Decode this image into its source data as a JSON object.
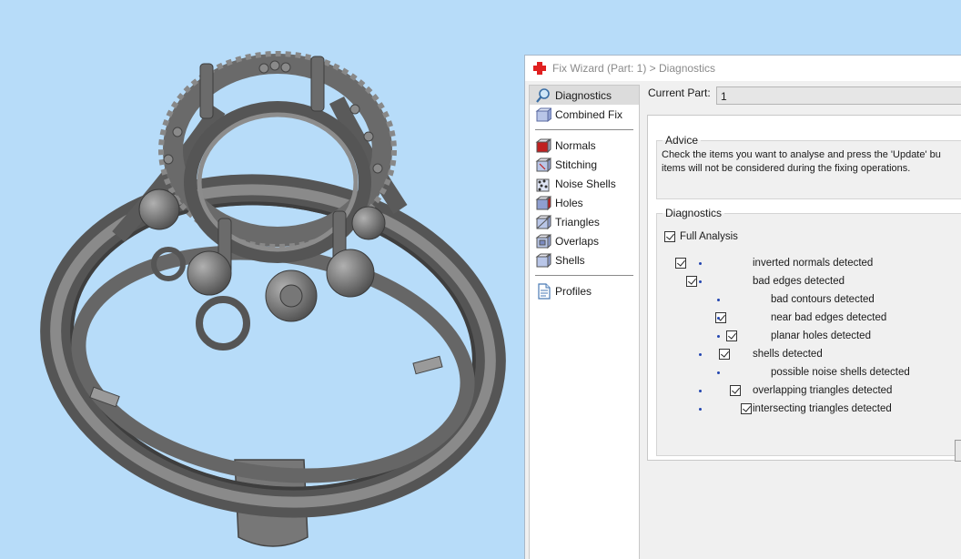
{
  "window": {
    "title": "Fix Wizard (Part: 1) > Diagnostics"
  },
  "nav": {
    "top_items": [
      {
        "label": "Diagnostics",
        "icon": "magnifier-icon",
        "selected": true
      },
      {
        "label": "Combined Fix",
        "icon": "combined-fix-icon",
        "selected": false
      }
    ],
    "fix_items": [
      {
        "label": "Normals",
        "icon": "normals-icon"
      },
      {
        "label": "Stitching",
        "icon": "stitching-icon"
      },
      {
        "label": "Noise Shells",
        "icon": "noise-shells-icon"
      },
      {
        "label": "Holes",
        "icon": "holes-icon"
      },
      {
        "label": "Triangles",
        "icon": "triangles-icon"
      },
      {
        "label": "Overlaps",
        "icon": "overlaps-icon"
      },
      {
        "label": "Shells",
        "icon": "shells-icon"
      }
    ],
    "bottom_items": [
      {
        "label": "Profiles",
        "icon": "document-icon"
      }
    ]
  },
  "current_part": {
    "label": "Current Part:",
    "value": "1"
  },
  "advice": {
    "title": "Advice",
    "line1": "Check the items you want to analyse and press the 'Update' bu",
    "line2": "items will not be considered during the fixing operations."
  },
  "diagnostics": {
    "title": "Diagnostics",
    "full_analysis_label": "Full Analysis",
    "full_analysis_checked": true,
    "items": [
      {
        "label": "inverted normals detected",
        "checked": true,
        "level": 0,
        "has_checkbox": true
      },
      {
        "label": "bad edges detected",
        "checked": true,
        "level": 0,
        "has_checkbox": true
      },
      {
        "label": "bad contours detected",
        "checked": false,
        "level": 1,
        "has_checkbox": false
      },
      {
        "label": "near bad edges detected",
        "checked": true,
        "level": 1,
        "has_checkbox": true
      },
      {
        "label": "planar holes detected",
        "checked": true,
        "level": 1,
        "has_checkbox": true
      },
      {
        "label": "shells detected",
        "checked": true,
        "level": 0,
        "has_checkbox": true
      },
      {
        "label": "possible noise shells detected",
        "checked": false,
        "level": 1,
        "has_checkbox": false
      },
      {
        "label": "overlapping triangles detected",
        "checked": true,
        "level": 0,
        "has_checkbox": true
      },
      {
        "label": "intersecting triangles detected",
        "checked": true,
        "level": 0,
        "has_checkbox": true
      }
    ]
  },
  "colors": {
    "viewport_bg": "#b7dcf9",
    "model": "#6b6b6b",
    "accent_red": "#e02020"
  }
}
